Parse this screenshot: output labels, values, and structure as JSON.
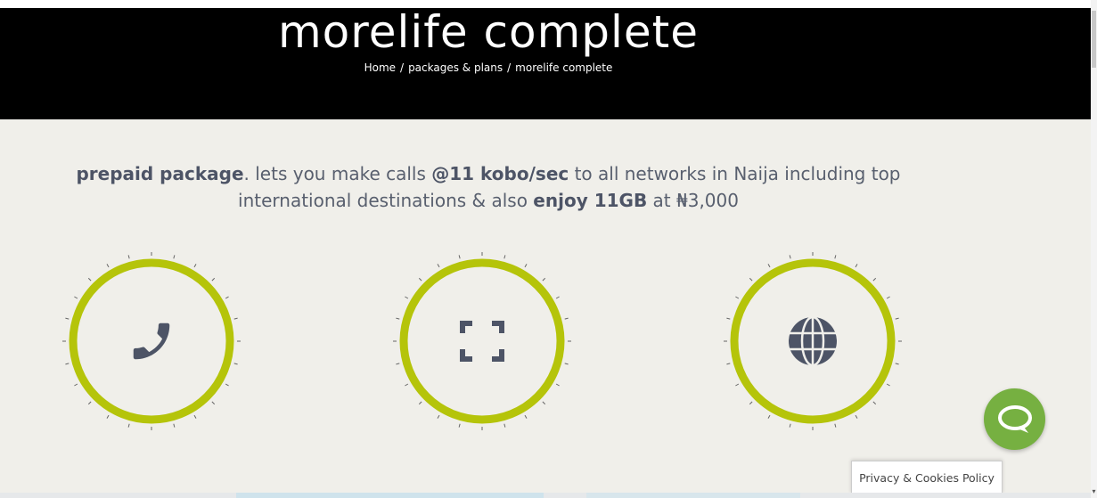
{
  "hero": {
    "title": "morelife complete",
    "breadcrumb": {
      "home": "Home",
      "sep": "/",
      "packages": "packages & plans",
      "current": "morelife complete"
    }
  },
  "intro": {
    "part1_bold": "prepaid package",
    "part2": ". lets you make calls ",
    "part3_bold": "@11 kobo/sec",
    "part4": " to all networks in Naija including top international destinations & also ",
    "part5_bold": "enjoy 11GB",
    "part6": " at ₦3,000"
  },
  "features": [
    {
      "icon": "phone-icon"
    },
    {
      "icon": "fullscreen-icon"
    },
    {
      "icon": "globe-icon"
    }
  ],
  "colors": {
    "ring": "#b5c40a",
    "icon": "#4d5466",
    "chat": "#76b041",
    "background": "#f0efea"
  },
  "chat": {
    "icon": "chat-bubble-icon"
  },
  "privacy": {
    "label": "Privacy & Cookies Policy"
  }
}
